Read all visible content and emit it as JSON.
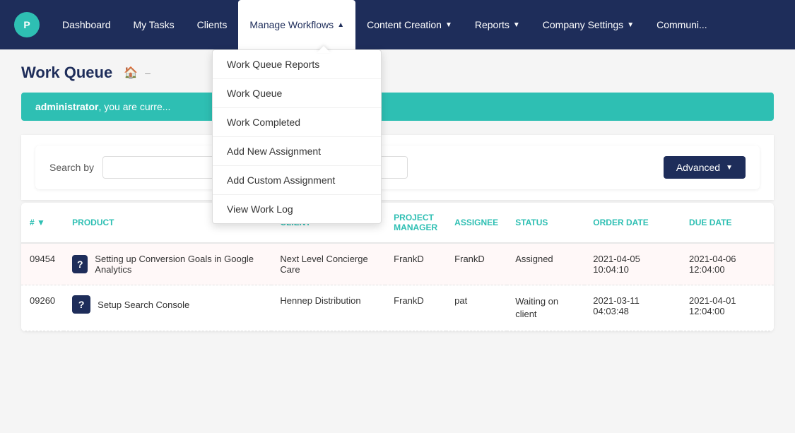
{
  "nav": {
    "items": [
      {
        "label": "Dashboard",
        "has_dropdown": false
      },
      {
        "label": "My Tasks",
        "has_dropdown": false
      },
      {
        "label": "Clients",
        "has_dropdown": false
      },
      {
        "label": "Manage Workflows",
        "has_dropdown": true,
        "active": true
      },
      {
        "label": "Content Creation",
        "has_dropdown": true
      },
      {
        "label": "Reports",
        "has_dropdown": true
      },
      {
        "label": "Company Settings",
        "has_dropdown": true
      },
      {
        "label": "Communi...",
        "has_dropdown": false
      }
    ]
  },
  "dropdown": {
    "items": [
      {
        "label": "Work Queue Reports"
      },
      {
        "label": "Work Queue"
      },
      {
        "label": "Work Completed"
      },
      {
        "label": "Add New Assignment"
      },
      {
        "label": "Add Custom Assignment"
      },
      {
        "label": "View Work Log"
      }
    ]
  },
  "page": {
    "title": "Work Queue",
    "breadcrumb_home": "🏠",
    "breadcrumb_sep": "–"
  },
  "banner": {
    "prefix": "administrator",
    "text": ", you are curre..."
  },
  "search": {
    "label": "Search by",
    "placeholder1": "",
    "placeholder2": "",
    "advanced_label": "Advanced",
    "caret": "▼"
  },
  "table": {
    "headers": [
      "#",
      "PRODUCT",
      "CLIENT",
      "PROJECT MANAGER",
      "ASSIGNEE",
      "STATUS",
      "ORDER DATE",
      "DUE DATE"
    ],
    "rows": [
      {
        "id": "09454",
        "badge": "?",
        "product": "Setting up Conversion Goals in Google Analytics",
        "client": "Next Level Concierge Care",
        "manager": "FrankD",
        "assignee": "FrankD",
        "status": "Assigned",
        "order_date": "2021-04-05 10:04:10",
        "due_date": "2021-04-06 12:04:00"
      },
      {
        "id": "09260",
        "badge": "?",
        "product": "Setup Search Console",
        "client": "Hennep Distribution",
        "manager": "FrankD",
        "assignee": "pat",
        "status": "Waiting on client",
        "order_date": "2021-03-11 04:03:48",
        "due_date": "2021-04-01 12:04:00"
      }
    ]
  }
}
